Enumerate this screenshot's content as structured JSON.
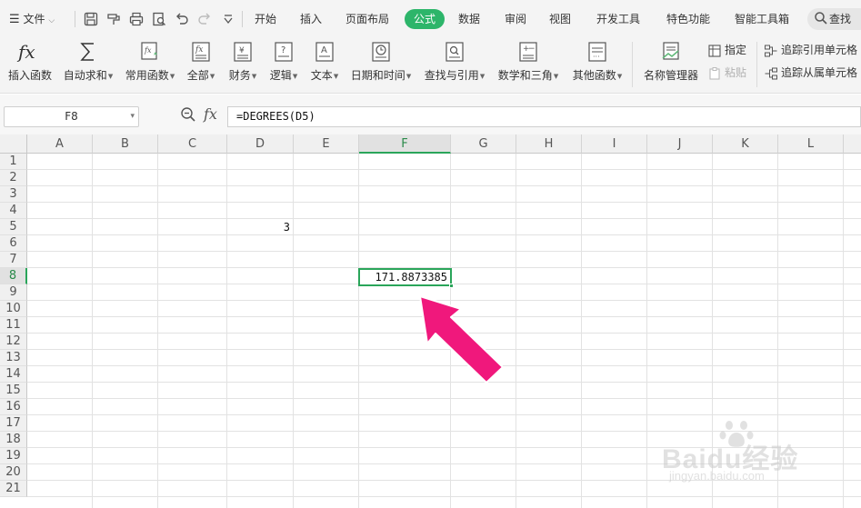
{
  "menubar": {
    "file_label": "文件",
    "tabs": [
      {
        "label": "开始"
      },
      {
        "label": "插入"
      },
      {
        "label": "页面布局"
      },
      {
        "label": "公式",
        "active": true
      },
      {
        "label": "数据"
      },
      {
        "label": "审阅"
      },
      {
        "label": "视图"
      },
      {
        "label": "开发工具"
      },
      {
        "label": "特色功能"
      },
      {
        "label": "智能工具箱"
      }
    ],
    "search_label": "查找",
    "active_tab_color": "#2db56a"
  },
  "ribbon": {
    "buttons": [
      {
        "label": "插入函数",
        "icon": "fx-icon"
      },
      {
        "label": "自动求和",
        "icon": "sigma-icon",
        "has_dropdown": true
      },
      {
        "label": "常用函数",
        "icon": "common-function-icon",
        "has_dropdown": true
      },
      {
        "label": "全部",
        "icon": "all-functions-icon",
        "has_dropdown": true
      },
      {
        "label": "财务",
        "icon": "finance-icon",
        "has_dropdown": true
      },
      {
        "label": "逻辑",
        "icon": "logic-icon",
        "has_dropdown": true
      },
      {
        "label": "文本",
        "icon": "text-function-icon",
        "has_dropdown": true
      },
      {
        "label": "日期和时间",
        "icon": "clock-icon",
        "has_dropdown": true
      },
      {
        "label": "查找与引用",
        "icon": "lookup-icon",
        "has_dropdown": true
      },
      {
        "label": "数学和三角",
        "icon": "math-icon",
        "has_dropdown": true
      },
      {
        "label": "其他函数",
        "icon": "other-functions-icon",
        "has_dropdown": true
      },
      {
        "label": "名称管理器",
        "icon": "name-manager-icon"
      }
    ],
    "small": {
      "define_label": "指定",
      "paste_label": "粘贴",
      "trace_precedents_label": "追踪引用单元格",
      "trace_dependents_label": "追踪从属单元格"
    }
  },
  "formula_bar": {
    "name_box": "F8",
    "fx_label": "fx",
    "formula": "=DEGREES(D5)"
  },
  "sheet": {
    "columns": [
      "A",
      "B",
      "C",
      "D",
      "E",
      "F",
      "G",
      "H",
      "I",
      "J",
      "K",
      "L"
    ],
    "rows": [
      "1",
      "2",
      "3",
      "4",
      "5",
      "6",
      "7",
      "8",
      "9",
      "10",
      "11",
      "12",
      "13",
      "14",
      "15",
      "16",
      "17",
      "18",
      "19",
      "20",
      "21"
    ],
    "selected_column": "F",
    "selected_row": "8",
    "cells": {
      "D5": "3",
      "F8": "171.8873385"
    },
    "selection_color": "#2aa55a"
  },
  "annotation": {
    "arrow_color": "#f0187c"
  },
  "watermark": {
    "text": "Baidu经验",
    "sub": "jingyan.baidu.com"
  }
}
